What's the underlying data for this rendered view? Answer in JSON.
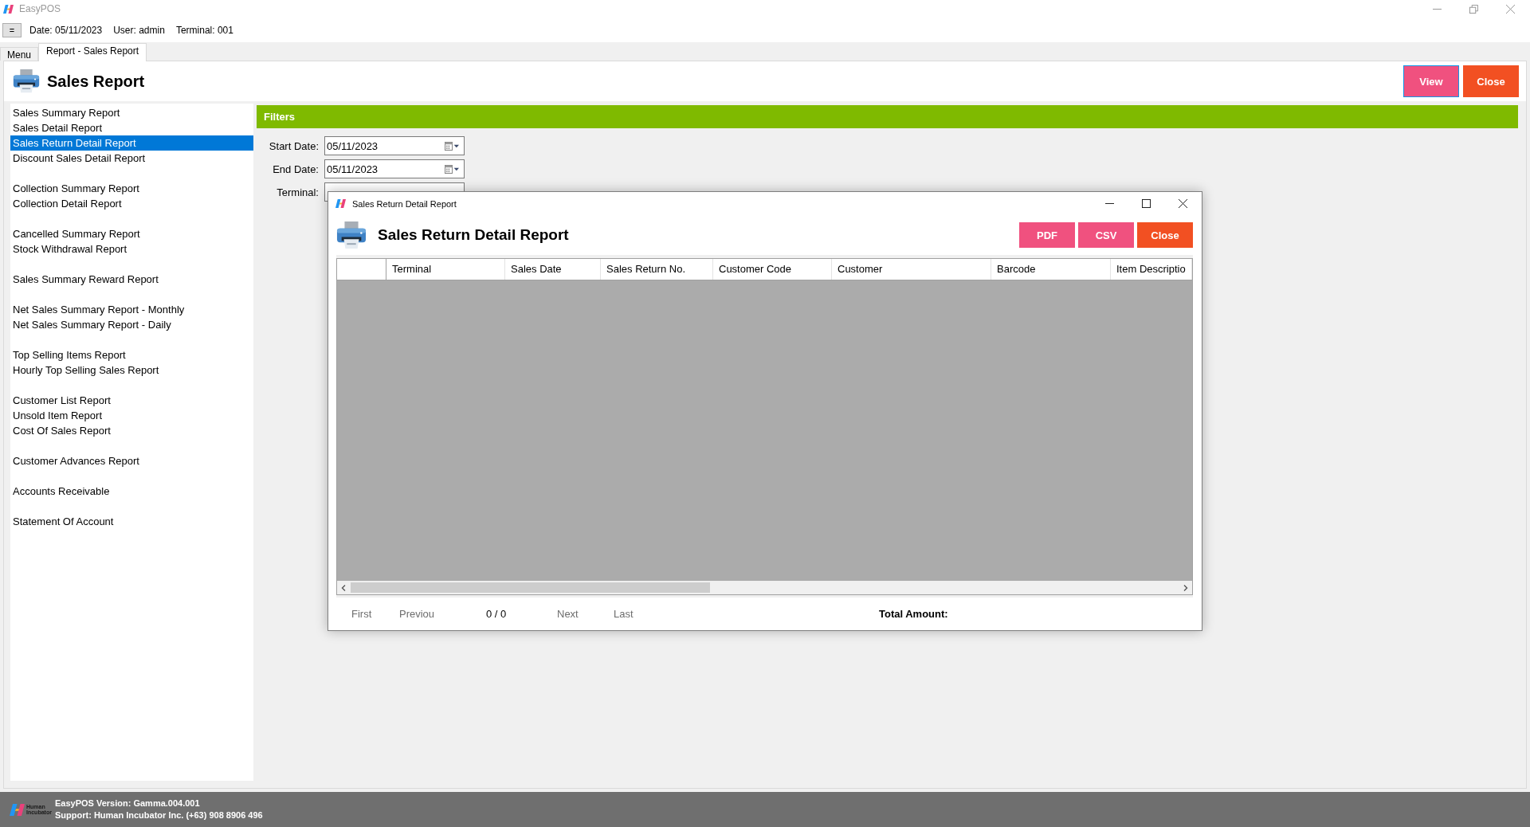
{
  "window": {
    "title": "EasyPOS"
  },
  "info_bar": {
    "menu_button": "=",
    "date": "Date: 05/11/2023",
    "user": "User: admin",
    "terminal": "Terminal: 001"
  },
  "tabs": [
    {
      "label": "Menu",
      "selected": false
    },
    {
      "label": "Report - Sales Report",
      "selected": true
    }
  ],
  "page": {
    "title": "Sales Report",
    "buttons": [
      {
        "label": "View",
        "kind": "view",
        "focused": true
      },
      {
        "label": "Close",
        "kind": "close",
        "focused": false
      }
    ]
  },
  "report_list": {
    "groups": [
      {
        "items": [
          {
            "label": "Sales Summary Report",
            "selected": false
          },
          {
            "label": "Sales Detail Report",
            "selected": false
          },
          {
            "label": "Sales Return Detail Report",
            "selected": true
          },
          {
            "label": "Discount Sales Detail Report",
            "selected": false
          }
        ]
      },
      {
        "items": [
          {
            "label": "Collection Summary Report",
            "selected": false
          },
          {
            "label": "Collection Detail Report",
            "selected": false
          }
        ]
      },
      {
        "items": [
          {
            "label": "Cancelled Summary Report",
            "selected": false
          },
          {
            "label": "Stock Withdrawal Report",
            "selected": false
          }
        ]
      },
      {
        "items": [
          {
            "label": "Sales Summary Reward Report",
            "selected": false
          }
        ]
      },
      {
        "items": [
          {
            "label": "Net Sales Summary Report - Monthly",
            "selected": false
          },
          {
            "label": "Net Sales Summary Report - Daily",
            "selected": false
          }
        ]
      },
      {
        "items": [
          {
            "label": "Top Selling Items Report",
            "selected": false
          },
          {
            "label": "Hourly Top Selling Sales Report",
            "selected": false
          }
        ]
      },
      {
        "items": [
          {
            "label": "Customer List Report",
            "selected": false
          },
          {
            "label": "Unsold Item Report",
            "selected": false
          },
          {
            "label": "Cost Of Sales Report",
            "selected": false
          }
        ]
      },
      {
        "items": [
          {
            "label": "Customer Advances Report",
            "selected": false
          }
        ]
      },
      {
        "items": [
          {
            "label": "Accounts Receivable",
            "selected": false
          }
        ]
      },
      {
        "items": [
          {
            "label": "Statement Of Account",
            "selected": false
          }
        ]
      }
    ]
  },
  "filters": {
    "title": "Filters",
    "fields": [
      {
        "label": "Start Date:",
        "kind": "date",
        "value": "05/11/2023"
      },
      {
        "label": "End Date:",
        "kind": "date",
        "value": "05/11/2023"
      },
      {
        "label": "Terminal:",
        "kind": "text"
      }
    ]
  },
  "dialog": {
    "title": "Sales Return Detail Report",
    "heading": "Sales Return Detail Report",
    "buttons": [
      {
        "label": "PDF",
        "kind": "pdf"
      },
      {
        "label": "CSV",
        "kind": "csv"
      },
      {
        "label": "Close",
        "kind": "close"
      }
    ],
    "table": {
      "columns": [
        "Terminal",
        "Sales Date",
        "Sales Return No.",
        "Customer Code",
        "Customer",
        "Barcode",
        "Item Descriptio"
      ]
    },
    "pager": {
      "first": "First",
      "previous": "Previou",
      "count": "0 / 0",
      "next": "Next",
      "last": "Last"
    },
    "total_label": "Total Amount:"
  },
  "status_bar": {
    "logo_text": "Human Incubator",
    "version": "EasyPOS Version: Gamma.004.001",
    "support": "Support: Human Incubator Inc. (+63) 908 8906 496"
  }
}
